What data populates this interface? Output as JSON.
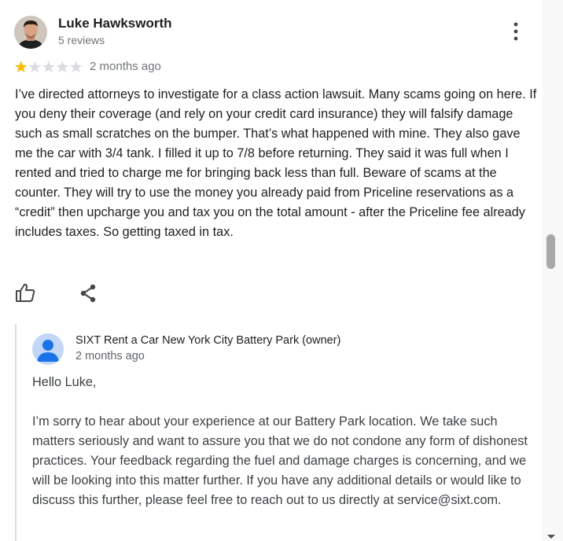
{
  "review": {
    "author": "Luke Hawksworth",
    "author_meta": "5 reviews",
    "rating": 1,
    "rating_max": 5,
    "date": "2 months ago",
    "text": "I’ve directed attorneys to investigate for a class action lawsuit. Many scams going on here. If you deny their coverage (and rely on your credit card insurance) they will falsify damage such as small scratches on the bumper. That’s what happened with mine. They also gave me the car with 3/4 tank. I filled it up to 7/8 before returning. They said it was full when I rented and tried to charge me for bringing back less than full. Beware of scams at the counter. They will try to use the money you already paid from Priceline reservations as a “credit” then upcharge you and tax you on the total amount - after the Priceline fee already includes taxes. So getting taxed in tax.",
    "icons": {
      "more": "more-vert-icon",
      "like": "thumb-up-icon",
      "share": "share-icon"
    }
  },
  "owner_reply": {
    "name": "SIXT Rent a Car New York City Battery Park (owner)",
    "date": "2 months ago",
    "greeting": "Hello Luke,",
    "body": "I’m sorry to hear about your experience at our Battery Park location. We take such matters seriously and want to assure you that we do not condone any form of dishonest practices. Your feedback regarding the fuel and damage charges is concerning, and we will be looking into this matter further. If you have any additional details or would like to discuss this further, please feel free to reach out to us directly at service@sixt.com."
  },
  "colors": {
    "star_filled": "#fbbc04",
    "star_empty": "#dadce0",
    "icon": "#444746",
    "owner_avatar_bg": "#a8c7fa",
    "owner_avatar_fg": "#1a73e8"
  }
}
